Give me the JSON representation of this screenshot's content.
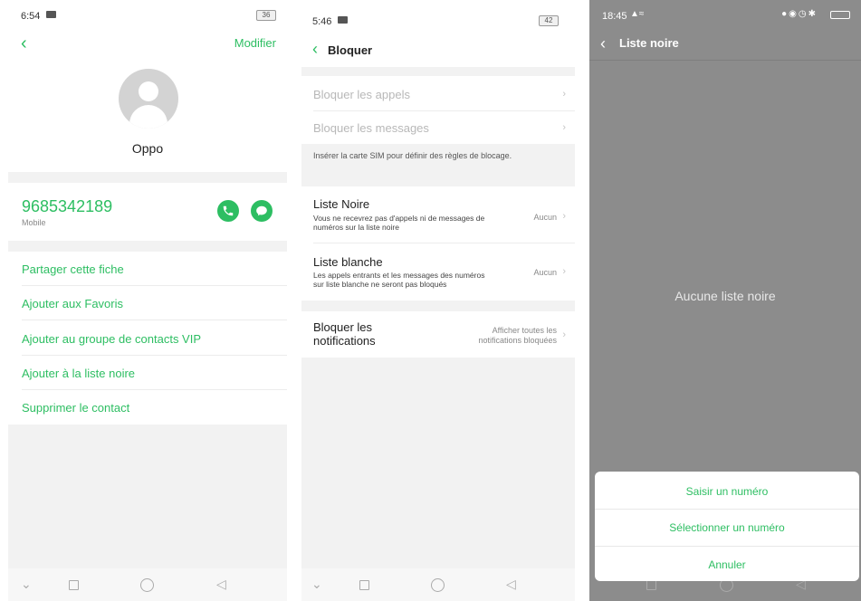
{
  "panel1": {
    "time": "6:54",
    "battery": "36",
    "modify_label": "Modifier",
    "contact_name": "Oppo",
    "phone_number": "9685342189",
    "phone_type": "Mobile",
    "actions": [
      "Partager cette fiche",
      "Ajouter aux Favoris",
      "Ajouter au groupe de contacts VIP",
      "Ajouter à la liste noire",
      "Supprimer le contact"
    ]
  },
  "panel2": {
    "time": "5:46",
    "battery": "42",
    "title": "Bloquer",
    "block_calls": "Bloquer les appels",
    "block_messages": "Bloquer les messages",
    "sim_hint": "Insérer la carte SIM pour définir des règles de blocage.",
    "blacklist_title": "Liste Noire",
    "blacklist_desc_1": "Vous ne recevrez pas d'appels ni de messages de",
    "blacklist_desc_2": "numéros sur la liste noire",
    "blacklist_value": "Aucun",
    "whitelist_title": "Liste blanche",
    "whitelist_desc_1": "Les appels entrants et les messages des numéros",
    "whitelist_desc_2": "sur liste blanche ne seront pas bloqués",
    "whitelist_value": "Aucun",
    "notif_title_1": "Bloquer les",
    "notif_title_2": "notifications",
    "notif_value_1": "Afficher toutes les",
    "notif_value_2": "notifications bloquées"
  },
  "panel3": {
    "time": "18:45",
    "title": "Liste noire",
    "empty_message": "Aucune liste noire",
    "sheet_options": [
      "Saisir un numéro",
      "Sélectionner un numéro",
      "Annuler"
    ]
  },
  "colors": {
    "accent": "#2dbe62",
    "divider": "#f2f2f2",
    "dim_overlay": "#8c8c8c"
  }
}
